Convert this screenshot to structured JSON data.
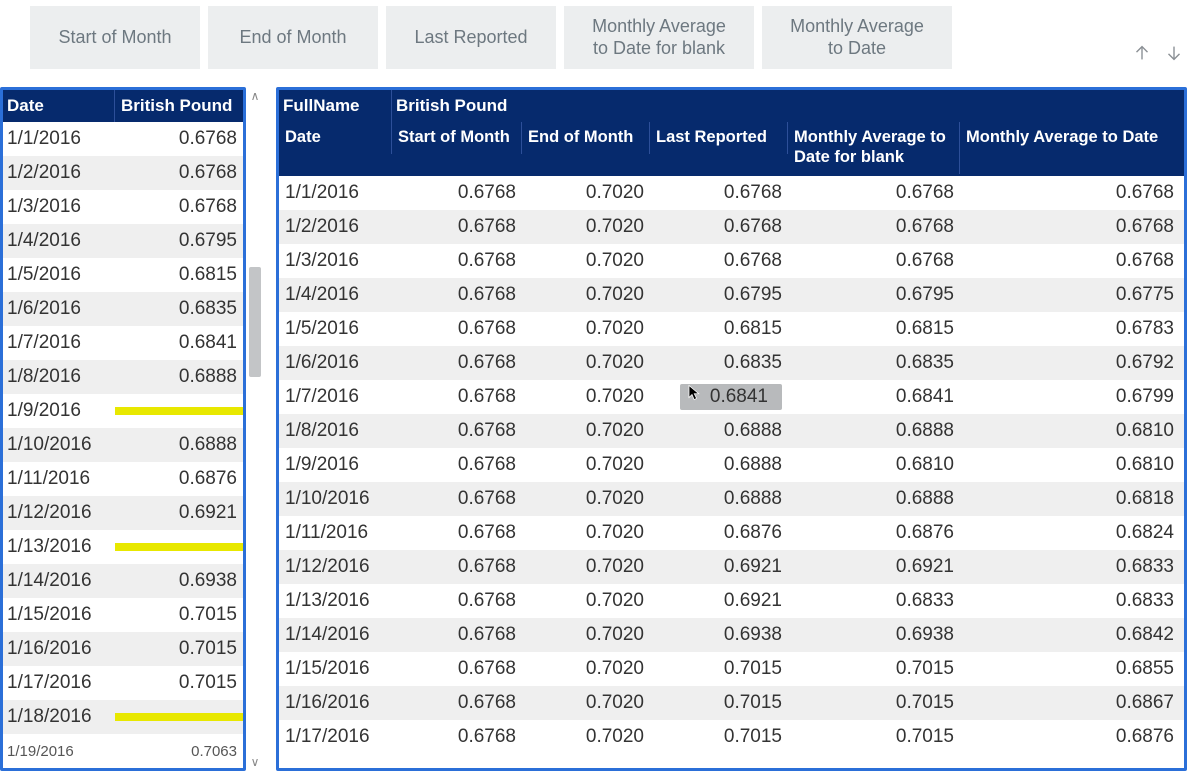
{
  "top_buttons": {
    "b0": "Start of Month",
    "b1": "End of Month",
    "b2": "Last Reported",
    "b3": "Monthly Average\nto Date for blank",
    "b4": "Monthly Average\nto Date"
  },
  "left_table": {
    "headers": {
      "date": "Date",
      "bp": "British Pound"
    },
    "rows": [
      {
        "date": "1/1/2016",
        "bp": "0.6768",
        "blank": false
      },
      {
        "date": "1/2/2016",
        "bp": "0.6768",
        "blank": false
      },
      {
        "date": "1/3/2016",
        "bp": "0.6768",
        "blank": false
      },
      {
        "date": "1/4/2016",
        "bp": "0.6795",
        "blank": false
      },
      {
        "date": "1/5/2016",
        "bp": "0.6815",
        "blank": false
      },
      {
        "date": "1/6/2016",
        "bp": "0.6835",
        "blank": false
      },
      {
        "date": "1/7/2016",
        "bp": "0.6841",
        "blank": false
      },
      {
        "date": "1/8/2016",
        "bp": "0.6888",
        "blank": false
      },
      {
        "date": "1/9/2016",
        "bp": "",
        "blank": true
      },
      {
        "date": "1/10/2016",
        "bp": "0.6888",
        "blank": false
      },
      {
        "date": "1/11/2016",
        "bp": "0.6876",
        "blank": false
      },
      {
        "date": "1/12/2016",
        "bp": "0.6921",
        "blank": false
      },
      {
        "date": "1/13/2016",
        "bp": "",
        "blank": true
      },
      {
        "date": "1/14/2016",
        "bp": "0.6938",
        "blank": false
      },
      {
        "date": "1/15/2016",
        "bp": "0.7015",
        "blank": false
      },
      {
        "date": "1/16/2016",
        "bp": "0.7015",
        "blank": false
      },
      {
        "date": "1/17/2016",
        "bp": "0.7015",
        "blank": false
      },
      {
        "date": "1/18/2016",
        "bp": "",
        "blank": true
      },
      {
        "date": "1/19/2016",
        "bp": "0.7063",
        "blank": false,
        "last_partial": true
      }
    ]
  },
  "right_table": {
    "fullname_label": "FullName",
    "fullname_value": "British Pound",
    "headers": {
      "date": "Date",
      "som": "Start of Month",
      "eom": "End of Month",
      "lr": "Last Reported",
      "mavgb": "Monthly Average to Date for blank",
      "mavg": "Monthly Average to Date"
    },
    "rows": [
      {
        "date": "1/1/2016",
        "som": "0.6768",
        "eom": "0.7020",
        "lr": "0.6768",
        "mavgb": "0.6768",
        "mavg": "0.6768"
      },
      {
        "date": "1/2/2016",
        "som": "0.6768",
        "eom": "0.7020",
        "lr": "0.6768",
        "mavgb": "0.6768",
        "mavg": "0.6768"
      },
      {
        "date": "1/3/2016",
        "som": "0.6768",
        "eom": "0.7020",
        "lr": "0.6768",
        "mavgb": "0.6768",
        "mavg": "0.6768"
      },
      {
        "date": "1/4/2016",
        "som": "0.6768",
        "eom": "0.7020",
        "lr": "0.6795",
        "mavgb": "0.6795",
        "mavg": "0.6775"
      },
      {
        "date": "1/5/2016",
        "som": "0.6768",
        "eom": "0.7020",
        "lr": "0.6815",
        "mavgb": "0.6815",
        "mavg": "0.6783"
      },
      {
        "date": "1/6/2016",
        "som": "0.6768",
        "eom": "0.7020",
        "lr": "0.6835",
        "mavgb": "0.6835",
        "mavg": "0.6792"
      },
      {
        "date": "1/7/2016",
        "som": "0.6768",
        "eom": "0.7020",
        "lr": "0.6841",
        "mavgb": "0.6841",
        "mavg": "0.6799",
        "hover": true
      },
      {
        "date": "1/8/2016",
        "som": "0.6768",
        "eom": "0.7020",
        "lr": "0.6888",
        "mavgb": "0.6888",
        "mavg": "0.6810"
      },
      {
        "date": "1/9/2016",
        "som": "0.6768",
        "eom": "0.7020",
        "lr": "0.6888",
        "mavgb": "0.6810",
        "mavg": "0.6810"
      },
      {
        "date": "1/10/2016",
        "som": "0.6768",
        "eom": "0.7020",
        "lr": "0.6888",
        "mavgb": "0.6888",
        "mavg": "0.6818"
      },
      {
        "date": "1/11/2016",
        "som": "0.6768",
        "eom": "0.7020",
        "lr": "0.6876",
        "mavgb": "0.6876",
        "mavg": "0.6824"
      },
      {
        "date": "1/12/2016",
        "som": "0.6768",
        "eom": "0.7020",
        "lr": "0.6921",
        "mavgb": "0.6921",
        "mavg": "0.6833"
      },
      {
        "date": "1/13/2016",
        "som": "0.6768",
        "eom": "0.7020",
        "lr": "0.6921",
        "mavgb": "0.6833",
        "mavg": "0.6833"
      },
      {
        "date": "1/14/2016",
        "som": "0.6768",
        "eom": "0.7020",
        "lr": "0.6938",
        "mavgb": "0.6938",
        "mavg": "0.6842"
      },
      {
        "date": "1/15/2016",
        "som": "0.6768",
        "eom": "0.7020",
        "lr": "0.7015",
        "mavgb": "0.7015",
        "mavg": "0.6855"
      },
      {
        "date": "1/16/2016",
        "som": "0.6768",
        "eom": "0.7020",
        "lr": "0.7015",
        "mavgb": "0.7015",
        "mavg": "0.6867"
      },
      {
        "date": "1/17/2016",
        "som": "0.6768",
        "eom": "0.7020",
        "lr": "0.7015",
        "mavgb": "0.7015",
        "mavg": "0.6876"
      }
    ]
  }
}
